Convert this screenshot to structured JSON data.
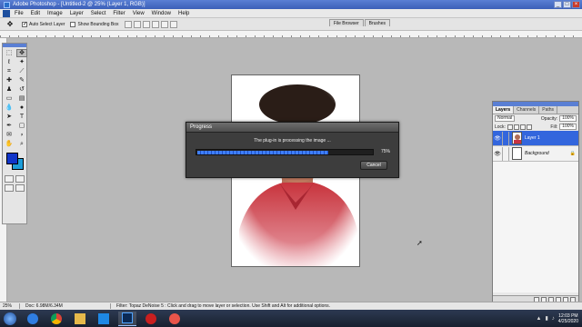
{
  "window": {
    "title": "Adobe Photoshop - [Untitled-2 @ 25% (Layer 1, RGB)]"
  },
  "menu": {
    "items": [
      "File",
      "Edit",
      "Image",
      "Layer",
      "Select",
      "Filter",
      "View",
      "Window",
      "Help"
    ]
  },
  "options": {
    "auto_select_label": "Auto Select Layer",
    "bounding_box_label": "Show Bounding Box"
  },
  "palette_well": {
    "tabs": [
      "File Browser",
      "Brushes"
    ]
  },
  "toolbox": {
    "foreground_color": "#1035c9",
    "background_color": "#1d9dd9"
  },
  "progress": {
    "title": "Progress",
    "message": "The plug-in is processing the image ...",
    "percent_label": "75%",
    "percent": 0.75,
    "cancel_label": "Cancel",
    "bar_color": "#3f7fff"
  },
  "layers_panel": {
    "tabs": [
      "Layers",
      "Channels",
      "Paths"
    ],
    "blend_mode": "Normal",
    "opacity_label": "Opacity:",
    "opacity": "100%",
    "lock_label": "Lock:",
    "fill_label": "Fill:",
    "fill": "100%",
    "layers": [
      {
        "name": "Layer 1",
        "selected": true
      },
      {
        "name": "Background",
        "selected": false
      }
    ]
  },
  "status": {
    "zoom": "25%",
    "doc": "Doc: 6.98M/6.34M",
    "hint": "Filter: Topaz DeNoise 5 : Click and drag to move layer or selection. Use Shift and Alt for additional options."
  },
  "taskbar": {
    "apps": [
      "ie-icon",
      "chrome-icon",
      "folder-icon",
      "vscode-icon",
      "photoshop-icon",
      "recorder-icon",
      "media-icon"
    ],
    "time": "12:03 PM",
    "date": "4/25/2020"
  }
}
